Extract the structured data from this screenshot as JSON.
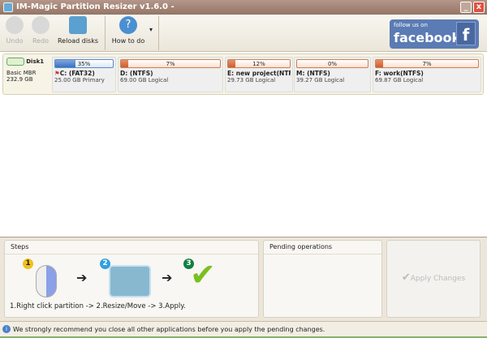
{
  "window": {
    "title": "IM-Magic Partition Resizer v1.6.0 -",
    "minimize": "_",
    "close": "x"
  },
  "toolbar": {
    "undo": "Undo",
    "redo": "Redo",
    "reload": "Reload disks",
    "howto": "How to do",
    "dropdown": "▾"
  },
  "facebook": {
    "small": "follow us on",
    "big": "facebook",
    "f": "f"
  },
  "disk": {
    "name": "Disk1",
    "type": "Basic MBR",
    "size": "232.9 GB"
  },
  "partitions": [
    {
      "percent": "35%",
      "used": 35,
      "name": "C: (FAT32)",
      "info": "25.00 GB Primary"
    },
    {
      "percent": "7%",
      "used": 7,
      "name": "D: (NTFS)",
      "info": "69.00 GB Logical"
    },
    {
      "percent": "12%",
      "used": 12,
      "name": "E: new project(NTF...",
      "info": "29.73 GB Logical"
    },
    {
      "percent": "0%",
      "used": 0,
      "name": "M: (NTFS)",
      "info": "39.27 GB Logical"
    },
    {
      "percent": "7%",
      "used": 7,
      "name": "F: work(NTFS)",
      "info": "69.87 GB Logical"
    }
  ],
  "steps": {
    "title": "Steps",
    "n1": "1",
    "n2": "2",
    "n3": "3",
    "arrow": "➔",
    "text": "1.Right click partition -> 2.Resize/Move -> 3.Apply."
  },
  "pending": {
    "title": "Pending operations"
  },
  "apply": {
    "label": "Apply Changes",
    "check": "✔"
  },
  "status": {
    "text": "We strongly recommend you close all other applications before you apply the pending changes.",
    "icon": "i"
  }
}
